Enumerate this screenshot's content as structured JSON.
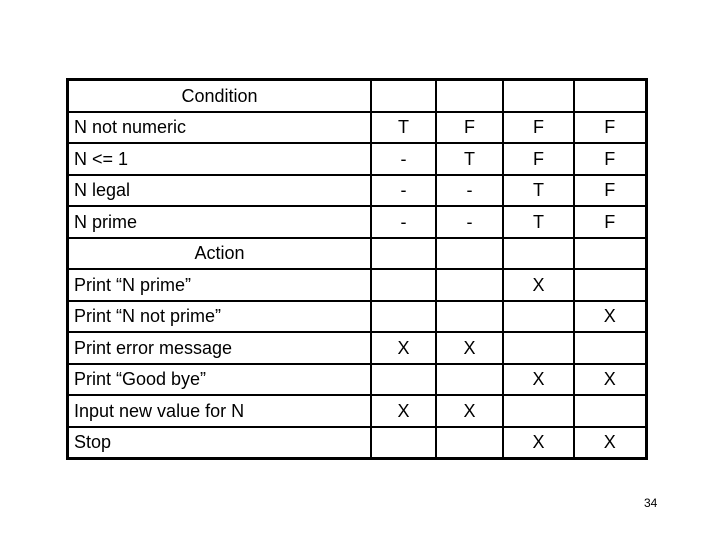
{
  "table": {
    "condition_header": "Condition",
    "conditions": [
      {
        "label": "N not numeric",
        "values": [
          "T",
          "F",
          "F",
          "F"
        ]
      },
      {
        "label": "N <= 1",
        "values": [
          "-",
          "T",
          "F",
          "F"
        ]
      },
      {
        "label": "N legal",
        "values": [
          "-",
          "-",
          "T",
          "F"
        ]
      },
      {
        "label": "N prime",
        "values": [
          "-",
          "-",
          "T",
          "F"
        ]
      }
    ],
    "action_header": "Action",
    "actions": [
      {
        "label": "Print “N prime”",
        "values": [
          "",
          "",
          "X",
          ""
        ]
      },
      {
        "label": "Print “N not prime”",
        "values": [
          "",
          "",
          "",
          "X"
        ]
      },
      {
        "label": "Print error message",
        "values": [
          "X",
          "X",
          "",
          ""
        ]
      },
      {
        "label": "Print “Good bye”",
        "values": [
          "",
          "",
          "X",
          "X"
        ]
      },
      {
        "label": "Input new value for N",
        "values": [
          "X",
          "X",
          "",
          ""
        ]
      },
      {
        "label": "Stop",
        "values": [
          "",
          "",
          "X",
          "X"
        ]
      }
    ]
  },
  "page_number": "34"
}
